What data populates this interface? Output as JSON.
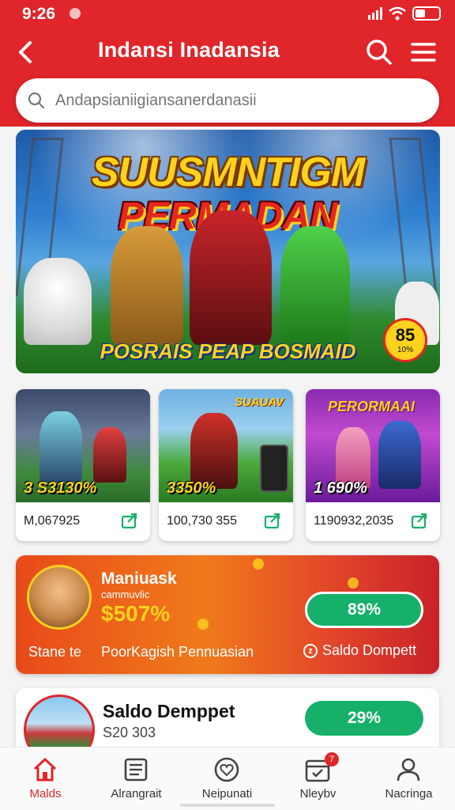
{
  "status": {
    "time": "9:26"
  },
  "header": {
    "title": "Indansi Inadansia",
    "search_placeholder": "Andapsianiigiansanerdanasii"
  },
  "hero": {
    "line1": "SUUSMNTIGM",
    "line2": "PERMADAN",
    "line3": "POSRAIS PEAP BOSMAID",
    "badge_number": "85",
    "badge_sub": "10%"
  },
  "cards": [
    {
      "price": "3 S3130%",
      "number": "M,067925"
    },
    {
      "price": "3350%",
      "number": "100,730 355",
      "label": "SUAUAV"
    },
    {
      "price": "1 690%",
      "number": "1190932,2035",
      "label": "PERORMAAI"
    }
  ],
  "promo": {
    "name": "Maniuask",
    "subtitle": "cammuvlic",
    "percent": "$507%",
    "pill": "89%",
    "left_label": "Stane te",
    "mid_label": "PoorKagish Pennuasian",
    "right_icon": "z",
    "right_label": "Saldo Dompett"
  },
  "saldo": {
    "title": "Saldo Demppet",
    "amount": "S20 303",
    "pill": "29%"
  },
  "nav": [
    {
      "label": "Malds",
      "icon": "home-icon"
    },
    {
      "label": "Alrangrait",
      "icon": "list-icon"
    },
    {
      "label": "Neipunati",
      "icon": "heart-icon"
    },
    {
      "label": "Nleybv",
      "icon": "calendar-icon",
      "badge": "7"
    },
    {
      "label": "Nacringa",
      "icon": "profile-icon"
    }
  ],
  "colors": {
    "brand": "#e0262a",
    "accent": "#16b06a",
    "promo": "#f07a1a"
  }
}
